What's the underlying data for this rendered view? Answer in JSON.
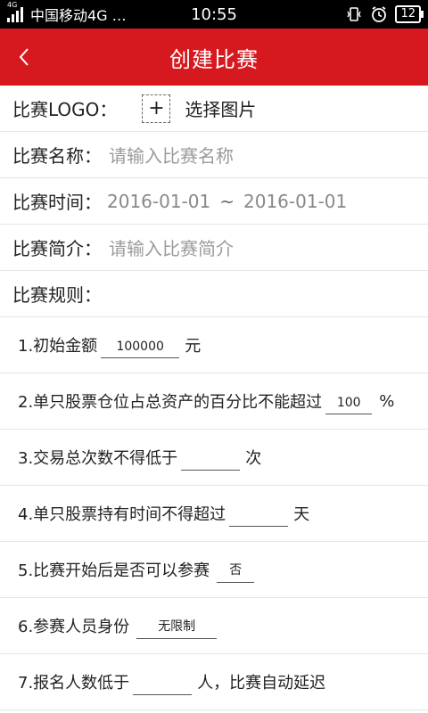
{
  "status": {
    "network_tag": "4G",
    "carrier": "中国移动4G …",
    "time": "10:55",
    "battery": "12"
  },
  "header": {
    "title": "创建比赛"
  },
  "form": {
    "logo_label": "比赛LOGO：",
    "logo_button_symbol": "+",
    "logo_select_text": "选择图片",
    "name_label": "比赛名称：",
    "name_placeholder": "请输入比赛名称",
    "time_label": "比赛时间：",
    "date_start": "2016-01-01",
    "date_sep": "~",
    "date_end": "2016-01-01",
    "intro_label": "比赛简介：",
    "intro_placeholder": "请输入比赛简介",
    "rules_label": "比赛规则："
  },
  "rules": [
    {
      "prefix": "1.初始金额",
      "value": "100000",
      "suffix": "元"
    },
    {
      "prefix": "2.单只股票仓位占总资产的百分比不能超过",
      "value": "100",
      "suffix": "%"
    },
    {
      "prefix": "3.交易总次数不得低于",
      "value": "",
      "suffix": "次"
    },
    {
      "prefix": "4.单只股票持有时间不得超过",
      "value": "",
      "suffix": "天"
    },
    {
      "prefix": "5.比赛开始后是否可以参赛",
      "value": "否",
      "suffix": ""
    },
    {
      "prefix": "6.参赛人员身份",
      "value": "无限制",
      "suffix": ""
    },
    {
      "prefix": "7.报名人数低于",
      "value": "",
      "suffix": "人，比赛自动延迟"
    }
  ]
}
